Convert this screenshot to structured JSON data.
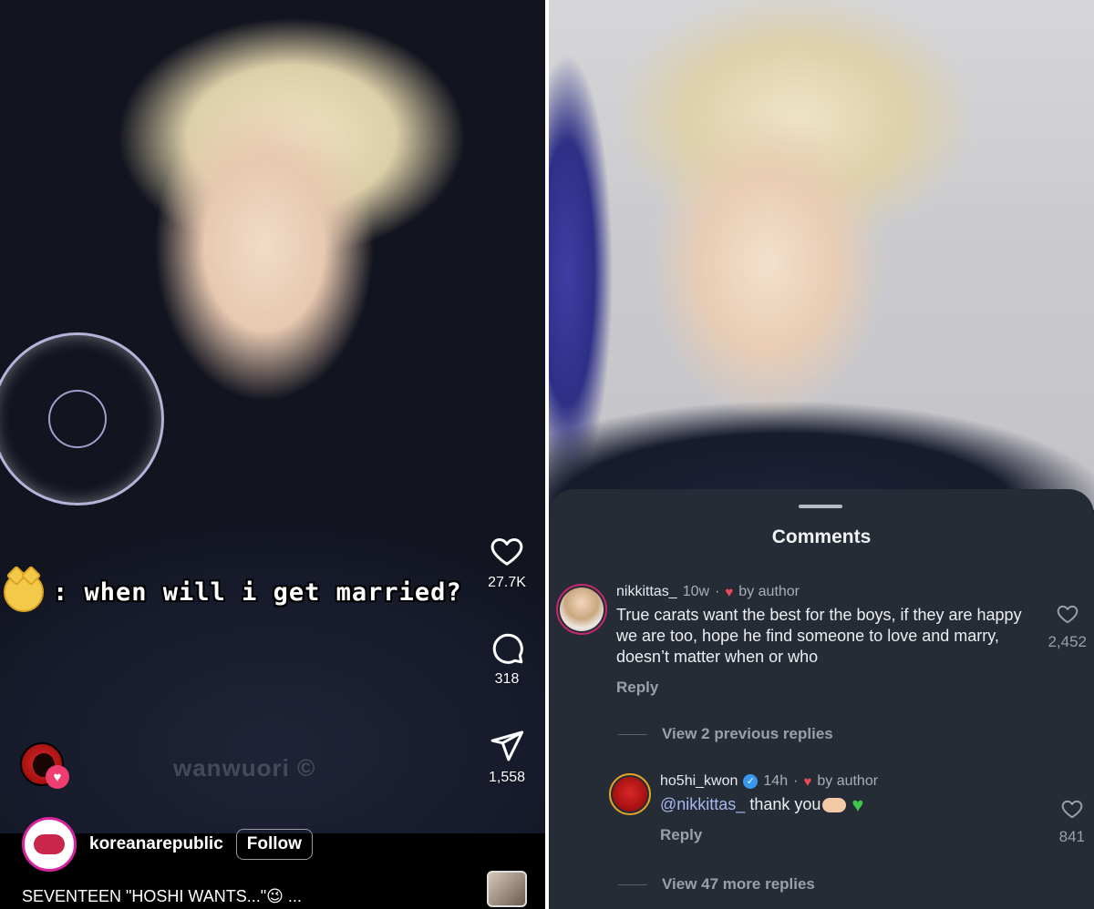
{
  "left_panel": {
    "caption": ": when will i get married?",
    "watermark": "wanwuori ©",
    "actions": {
      "likes": "27.7K",
      "comments": "318",
      "shares": "1,558",
      "more": "..."
    },
    "owner": {
      "username": "koreanarepublic",
      "follow_label": "Follow"
    },
    "description": "SEVENTEEN \"HOSHI WANTS...\"😉 ..."
  },
  "right_panel": {
    "sheet_title": "Comments",
    "comments": [
      {
        "username": "nikkittas_",
        "time": "10w",
        "separator": "·",
        "badge": "by author",
        "text": "True carats want the best for the boys, if they are happy we are too, hope he find someone to love and marry, doesn’t matter when or who",
        "reply_label": "Reply",
        "likes": "2,452"
      }
    ],
    "view_previous_replies": "View 2 previous replies",
    "reply": {
      "username": "ho5hi_kwon",
      "verified": true,
      "time": "14h",
      "separator": "·",
      "badge": "by author",
      "mention": "@nikkittas_",
      "text": "thank you",
      "reply_label": "Reply",
      "likes": "841"
    },
    "view_more_replies": "View 47 more replies"
  },
  "icons": {
    "heart": "heart-icon",
    "comment": "comment-bubble-icon",
    "share": "paper-plane-icon",
    "more": "more-dots-icon",
    "tiger": "tiger-emoji-icon",
    "verified": "verified-badge-icon"
  },
  "colors": {
    "sheet_bg": "#262c35",
    "verified_blue": "#3897f0",
    "heart_red": "#ed4956",
    "mention_blue": "#a6b8f0"
  }
}
